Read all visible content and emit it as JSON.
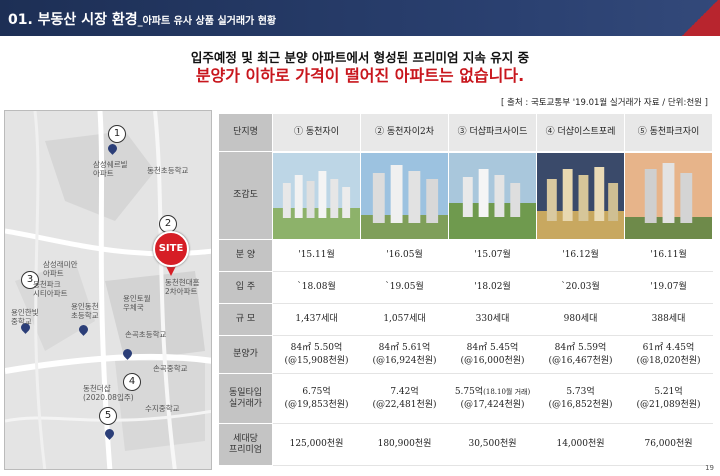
{
  "header": {
    "title": "01. 부동산 시장 환경",
    "subtitle": "_아파트 유사 상품 실거래가 현황"
  },
  "headline": {
    "line1": "입주예정 및 최근 분양 아파트에서 형성된 프리미엄 지속 유지 중",
    "line2": "분양가 이하로 가격이 떨어진 아파트는 없습니다."
  },
  "source": "[ 출처 : 국토교통부 '19.01월 실거래가 자료 / 단위:천원 ]",
  "map": {
    "site_label": "SITE",
    "markers": [
      "1",
      "2",
      "3",
      "4",
      "5"
    ],
    "labels": {
      "l1": "삼성쉐르빌\n아파트",
      "l2": "동천초등학교",
      "l3": "삼성래미안\n아파트",
      "l4": "동천현대홈\n2차아파트",
      "l5": "동천파크\n시티아파트",
      "l6": "용인한빛\n중학교",
      "l7": "용인동천\n초등학교",
      "l8": "동천더샵\n(2020.08입주)",
      "l9": "용인토월\n우체국",
      "l10": "손곡중학교",
      "l11": "손곡초등학교",
      "l12": "수지중학교"
    }
  },
  "table": {
    "corner": "단지명",
    "columns": [
      "① 동천자이",
      "② 동천자이2차",
      "③ 더샵파크사이드",
      "④ 더샵이스트포레",
      "⑤ 동천파크자이"
    ],
    "row_labels": {
      "photo": "조감도",
      "sale": "분 양",
      "move_in": "입 주",
      "scale": "규 모",
      "price": "분양가",
      "recent": "동일타입\n실거래가",
      "premium": "세대당\n프리미엄"
    },
    "sale": [
      "'15.11월",
      "'16.05월",
      "'15.07월",
      "'16.12월",
      "'16.11월"
    ],
    "move_in": [
      "`18.08월",
      "`19.05월",
      "'18.02월",
      "`20.03월",
      "'19.07월"
    ],
    "scale": [
      "1,437세대",
      "1,057세대",
      "330세대",
      "980세대",
      "388세대"
    ],
    "price": [
      {
        "main": "84㎡ 5.50억",
        "sub": "(@15,908천원)"
      },
      {
        "main": "84㎡ 5.61억",
        "sub": "(@16,924천원)"
      },
      {
        "main": "84㎡ 5.45억",
        "sub": "(@16,000천원)"
      },
      {
        "main": "84㎡ 5.59억",
        "sub": "(@16,467천원)"
      },
      {
        "main": "61㎡ 4.45억",
        "sub": "(@18,020천원)"
      }
    ],
    "recent": [
      {
        "main": "6.75억",
        "note": "",
        "sub": "(@19,853천원)"
      },
      {
        "main": "7.42억",
        "note": "",
        "sub": "(@22,481천원)"
      },
      {
        "main": "5.75억",
        "note": "(18.10월 거래)",
        "sub": "(@17,424천원)"
      },
      {
        "main": "5.73억",
        "note": "",
        "sub": "(@16,852천원)"
      },
      {
        "main": "5.21억",
        "note": "",
        "sub": "(@21,089천원)"
      }
    ],
    "premium": [
      "125,000천원",
      "180,900천원",
      "30,500천원",
      "14,000천원",
      "76,000천원"
    ]
  },
  "page_number": "19"
}
